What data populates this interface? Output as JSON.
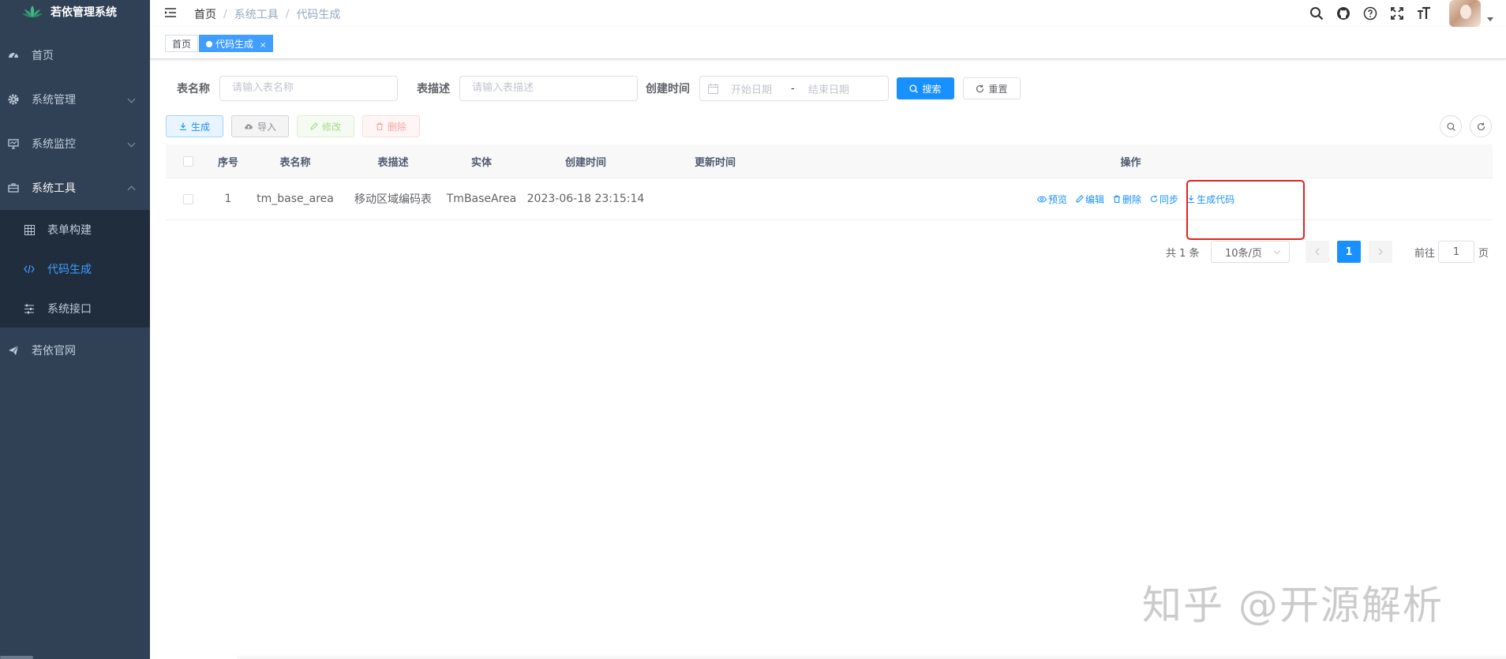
{
  "app": {
    "title": "若依管理系统",
    "logo_icon": "lotus-logo-icon"
  },
  "sidebar": {
    "items": [
      {
        "label": "首页",
        "icon": "dashboard-icon"
      },
      {
        "label": "系统管理",
        "icon": "gear-icon"
      },
      {
        "label": "系统监控",
        "icon": "monitor-icon"
      },
      {
        "label": "系统工具",
        "icon": "toolbox-icon"
      },
      {
        "label": "若依官网",
        "icon": "paper-plane-icon"
      }
    ],
    "submenu": [
      {
        "label": "表单构建",
        "icon": "grid-icon"
      },
      {
        "label": "代码生成",
        "icon": "code-icon"
      },
      {
        "label": "系统接口",
        "icon": "sliders-icon"
      }
    ]
  },
  "breadcrumb": [
    "首页",
    "系统工具",
    "代码生成"
  ],
  "tags": [
    {
      "label": "首页"
    },
    {
      "label": "代码生成",
      "close": "×"
    }
  ],
  "search": {
    "table_name_label": "表名称",
    "table_name_placeholder": "请输入表名称",
    "table_desc_label": "表描述",
    "table_desc_placeholder": "请输入表描述",
    "create_time_label": "创建时间",
    "start_placeholder": "开始日期",
    "range_sep": "-",
    "end_placeholder": "结束日期",
    "search_button": "搜索",
    "reset_button": "重置"
  },
  "toolbar": {
    "generate": "生成",
    "import": "导入",
    "edit": "修改",
    "delete": "删除"
  },
  "table": {
    "headers": [
      "序号",
      "表名称",
      "表描述",
      "实体",
      "创建时间",
      "更新时间",
      "操作"
    ],
    "rows": [
      {
        "index": "1",
        "table_name": "tm_base_area",
        "table_desc": "移动区域编码表",
        "entity": "TmBaseArea",
        "create_time": "2023-06-18 23:15:14",
        "update_time": ""
      }
    ],
    "actions": {
      "preview": "预览",
      "edit": "编辑",
      "delete": "删除",
      "sync": "同步",
      "generate_code": "生成代码"
    }
  },
  "pagination": {
    "total": "共 1 条",
    "page_size": "10条/页",
    "current_page": "1",
    "goto_label": "前往",
    "goto_value": "1",
    "page_suffix": "页"
  },
  "watermark": "知乎 @开源解析",
  "colors": {
    "sidebar": "#304156",
    "submenu": "#1f2d3d",
    "primary": "#1890ff",
    "highlight": "#e02222"
  }
}
